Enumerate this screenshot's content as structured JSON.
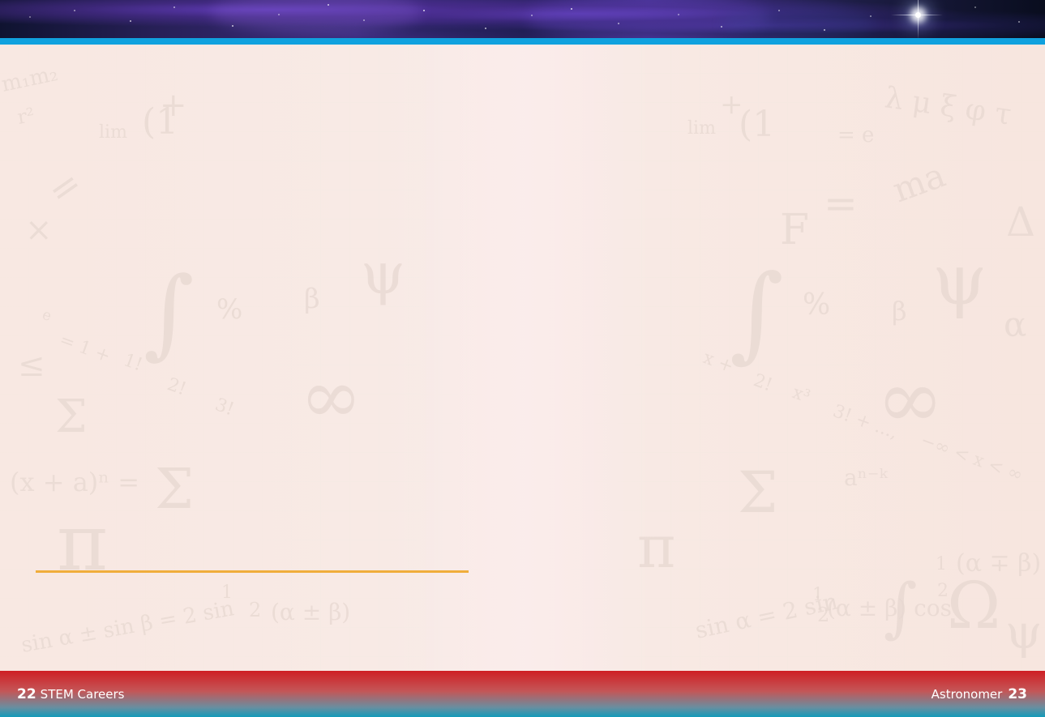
{
  "footer": {
    "left_page": {
      "number": "22",
      "label": "STEM Careers"
    },
    "right_page": {
      "label": "Astronomer",
      "number": "23"
    }
  },
  "colors": {
    "top_rule": "#10a1de",
    "paper": "#f8e8e2",
    "grid": "#ece4d5",
    "accent_rule": "#f0ad3b",
    "footer_red": "#cf1f24",
    "footer_blue": "#139ab9"
  },
  "icons": {
    "header_star": "bright-star-icon"
  }
}
